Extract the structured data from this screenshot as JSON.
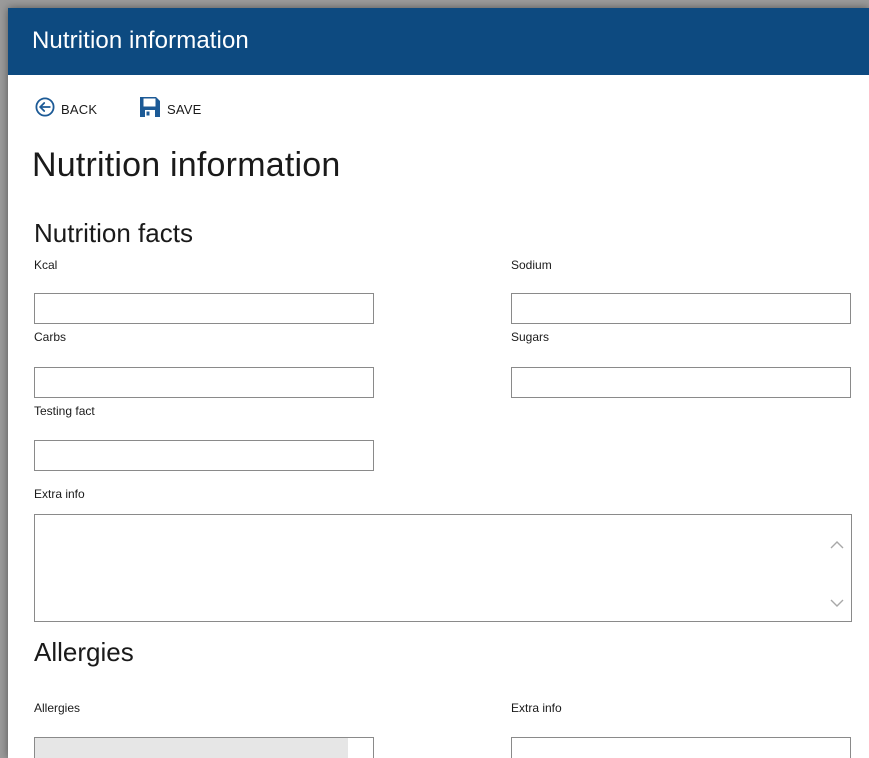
{
  "window": {
    "title": "Nutrition information"
  },
  "toolbar": {
    "back_label": "BACK",
    "save_label": "SAVE",
    "back_icon": "circle-arrow-left-icon",
    "save_icon": "floppy-disk-icon"
  },
  "page": {
    "title": "Nutrition information"
  },
  "nutrition_facts": {
    "title": "Nutrition facts",
    "fields": {
      "kcal": {
        "label": "Kcal",
        "value": ""
      },
      "sodium": {
        "label": "Sodium",
        "value": ""
      },
      "carbs": {
        "label": "Carbs",
        "value": ""
      },
      "sugars": {
        "label": "Sugars",
        "value": ""
      },
      "testing_fact": {
        "label": "Testing fact",
        "value": ""
      }
    },
    "extra_info": {
      "label": "Extra info",
      "value": ""
    }
  },
  "allergies": {
    "title": "Allergies",
    "allergies_field": {
      "label": "Allergies",
      "value": ""
    },
    "extra_info_field": {
      "label": "Extra info",
      "value": ""
    }
  },
  "colors": {
    "titlebar": "#0d4a80",
    "accent": "#1c5a96",
    "border": "#8a8a8a",
    "disabled_bg": "#e6e6e6"
  }
}
